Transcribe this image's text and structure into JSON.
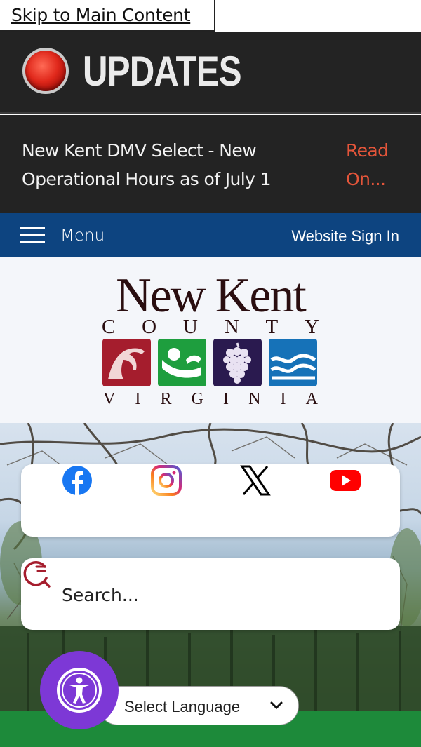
{
  "skip_link": "Skip to Main Content",
  "updates": {
    "title": "UPDATES",
    "headline": "New Kent DMV Select - New Operational Hours as of July 1",
    "read_more": "Read On..."
  },
  "nav": {
    "menu_label": "Menu",
    "sign_in": "Website Sign In"
  },
  "logo": {
    "name": "New Kent",
    "county": [
      "C",
      "O",
      "U",
      "N",
      "T",
      "Y"
    ],
    "state": [
      "V",
      "I",
      "R",
      "G",
      "I",
      "N",
      "I",
      "A"
    ],
    "tile_colors": [
      "#a51d2d",
      "#1e9e3e",
      "#2a1a4f",
      "#1672b8"
    ]
  },
  "social": [
    {
      "name": "facebook-icon",
      "color": "#1877f2"
    },
    {
      "name": "instagram-icon",
      "color": "#d62976"
    },
    {
      "name": "x-icon",
      "color": "#000000"
    },
    {
      "name": "youtube-icon",
      "color": "#ff0000"
    }
  ],
  "search": {
    "placeholder": "Search..."
  },
  "language": {
    "label": "Select Language"
  },
  "colors": {
    "header_bg": "#232323",
    "nav_bg": "#0d4480",
    "read_more": "#e4553a",
    "accessibility": "#7d38d6",
    "search_icon": "#a51d2d"
  }
}
